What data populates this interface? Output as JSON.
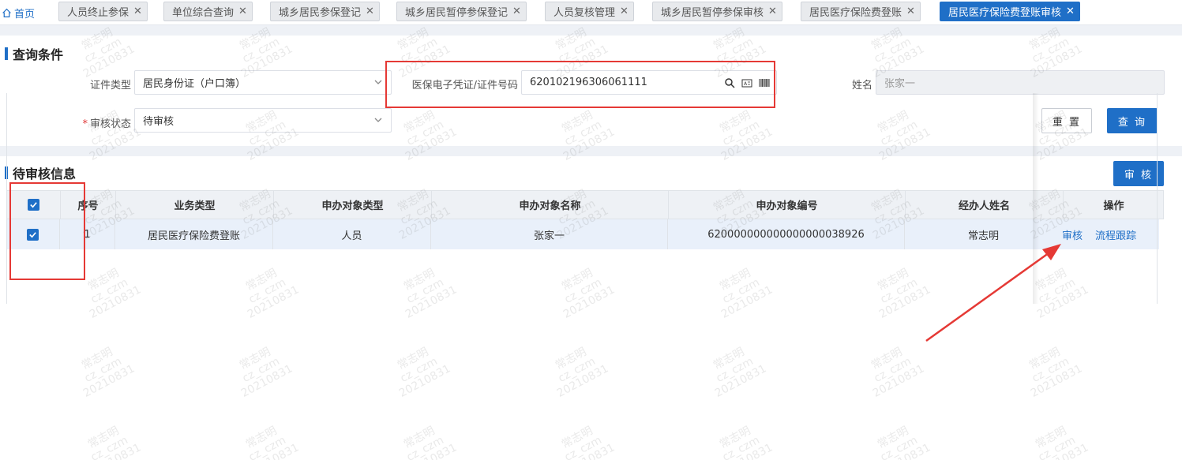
{
  "tabs": {
    "home": "首页",
    "items": [
      "人员终止参保",
      "单位综合查询",
      "城乡居民参保登记",
      "城乡居民暂停参保登记",
      "人员复核管理",
      "城乡居民暂停参保审核",
      "居民医疗保险费登账",
      "居民医疗保险费登账审核"
    ],
    "active_index": 7
  },
  "query": {
    "title": "查询条件",
    "id_type_label": "证件类型",
    "id_type_value": "居民身份证（户口簿）",
    "cert_label": "医保电子凭证/证件号码",
    "cert_value": "620102196306061111",
    "name_label": "姓名",
    "name_value": "张家一",
    "status_label": "审核状态",
    "status_value": "待审核",
    "reset_label": "重 置",
    "search_label": "查 询"
  },
  "pending": {
    "title": "待审核信息",
    "audit_label": "审 核",
    "columns": [
      "序号",
      "业务类型",
      "申办对象类型",
      "申办对象名称",
      "申办对象编号",
      "经办人姓名",
      "操作"
    ],
    "rows": [
      {
        "index": "1",
        "business_type": "居民医疗保险费登账",
        "object_type": "人员",
        "object_name": "张家一",
        "object_number": "620000000000000000038926",
        "handler": "常志明",
        "action_audit": "审核",
        "action_trace": "流程跟踪"
      }
    ]
  },
  "watermark": {
    "line1": "常志明",
    "line2": "cz_czm",
    "line3": "20210831"
  },
  "colors": {
    "primary": "#1f6fc7",
    "annotation": "#e53935"
  }
}
